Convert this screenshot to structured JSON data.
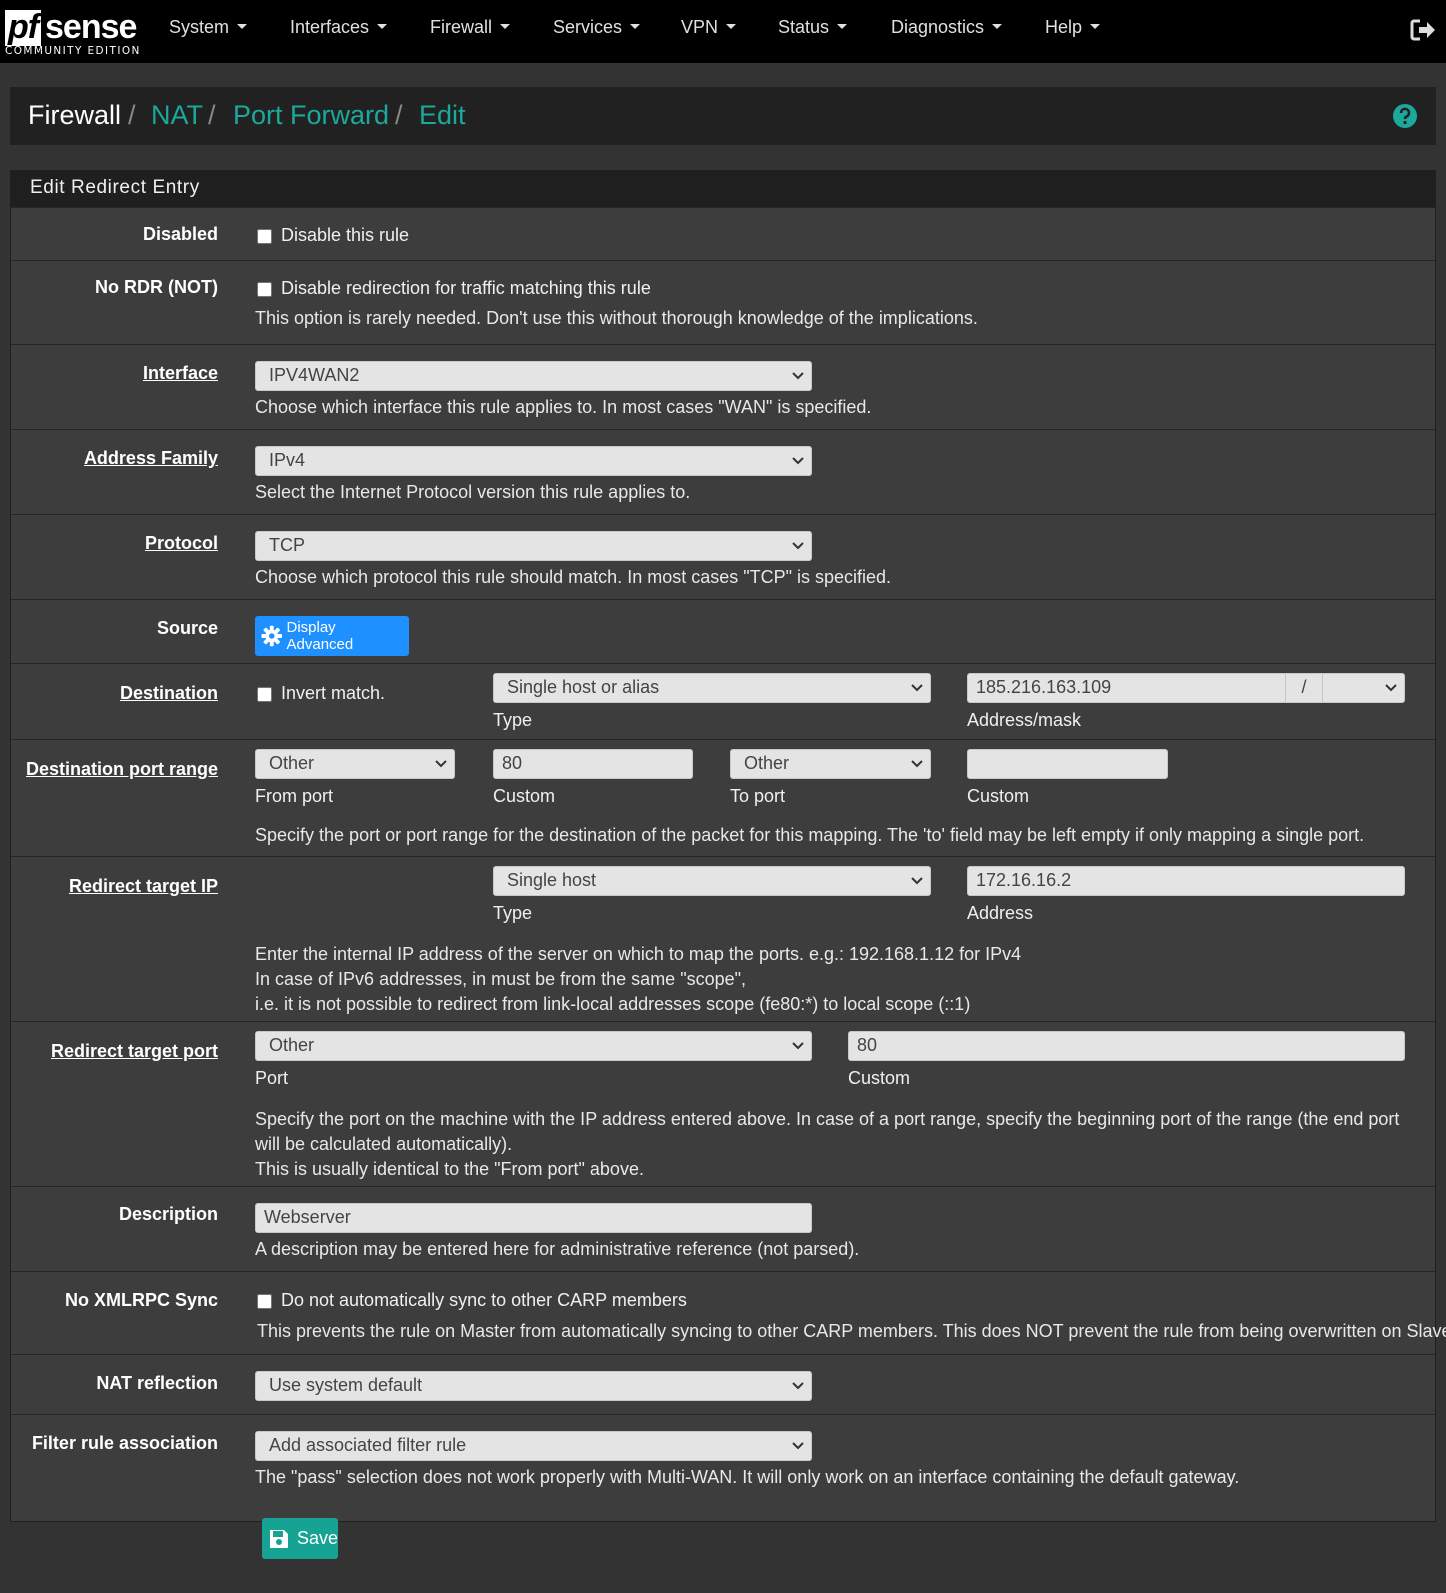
{
  "brand": {
    "logo_pf": "pf",
    "logo_sense": "sense",
    "edition": "COMMUNITY EDITION"
  },
  "nav": {
    "items": [
      "System",
      "Interfaces",
      "Firewall",
      "Services",
      "VPN",
      "Status",
      "Diagnostics",
      "Help"
    ],
    "logout_icon": "sign-out-icon"
  },
  "breadcrumb": {
    "items": [
      "Firewall",
      "NAT",
      "Port Forward",
      "Edit"
    ],
    "separator": "/",
    "help_icon": "question-circle-icon"
  },
  "panel": {
    "title": "Edit Redirect Entry"
  },
  "form": {
    "disabled": {
      "label": "Disabled",
      "checkbox_text": "Disable this rule",
      "checked": false
    },
    "nordr": {
      "label": "No RDR (NOT)",
      "checkbox_text": "Disable redirection for traffic matching this rule",
      "help": "This option is rarely needed. Don't use this without thorough knowledge of the implications.",
      "checked": false
    },
    "interface": {
      "label": "Interface",
      "value": "IPV4WAN2",
      "help": "Choose which interface this rule applies to. In most cases \"WAN\" is specified."
    },
    "address_family": {
      "label": "Address Family",
      "value": "IPv4",
      "help": "Select the Internet Protocol version this rule applies to."
    },
    "protocol": {
      "label": "Protocol",
      "value": "TCP",
      "help": "Choose which protocol this rule should match. In most cases \"TCP\" is specified."
    },
    "source": {
      "label": "Source",
      "button": "Display Advanced",
      "button_icon": "gear-icon"
    },
    "destination": {
      "label": "Destination",
      "invert_text": "Invert match.",
      "invert_checked": false,
      "type_value": "Single host or alias",
      "type_label": "Type",
      "address_value": "185.216.163.109",
      "mask_sep": "/",
      "mask_value": "",
      "address_label": "Address/mask"
    },
    "dest_port_range": {
      "label": "Destination port range",
      "from_value": "Other",
      "from_label": "From port",
      "from_custom": "80",
      "from_custom_label": "Custom",
      "to_value": "Other",
      "to_label": "To port",
      "to_custom": "",
      "to_custom_label": "Custom",
      "help": "Specify the port or port range for the destination of the packet for this mapping. The 'to' field may be left empty if only mapping a single port."
    },
    "redirect_ip": {
      "label": "Redirect target IP",
      "type_value": "Single host",
      "type_label": "Type",
      "address_value": "172.16.16.2",
      "address_label": "Address",
      "help_1": "Enter the internal IP address of the server on which to map the ports. e.g.: 192.168.1.12 for IPv4",
      "help_2": "In case of IPv6 addresses, in must be from the same \"scope\",",
      "help_3": "i.e. it is not possible to redirect from link-local addresses scope (fe80:*) to local scope (::1)"
    },
    "redirect_port": {
      "label": "Redirect target port",
      "port_value": "Other",
      "port_label": "Port",
      "custom_value": "80",
      "custom_label": "Custom",
      "help_1": "Specify the port on the machine with the IP address entered above. In case of a port range, specify the beginning port of the range (the end port will be calculated automatically).",
      "help_2": "This is usually identical to the \"From port\" above."
    },
    "description": {
      "label": "Description",
      "value": "Webserver",
      "help": "A description may be entered here for administrative reference (not parsed)."
    },
    "xmlrpc": {
      "label": "No XMLRPC Sync",
      "checkbox_text": "Do not automatically sync to other CARP members",
      "checked": false,
      "help": "This prevents the rule on Master from automatically syncing to other CARP members. This does NOT prevent the rule from being overwritten on Slave."
    },
    "nat_reflection": {
      "label": "NAT reflection",
      "value": "Use system default"
    },
    "filter_assoc": {
      "label": "Filter rule association",
      "value": "Add associated filter rule",
      "help": "The \"pass\" selection does not work properly with Multi-WAN. It will only work on an interface containing the default gateway."
    }
  },
  "save": {
    "label": "Save",
    "icon": "save-icon"
  },
  "colors": {
    "accent": "#1ba99c",
    "save": "#17a394",
    "advanced_button": "#1e90ff",
    "navbar": "#000000",
    "panel": "#3d3d3d"
  }
}
